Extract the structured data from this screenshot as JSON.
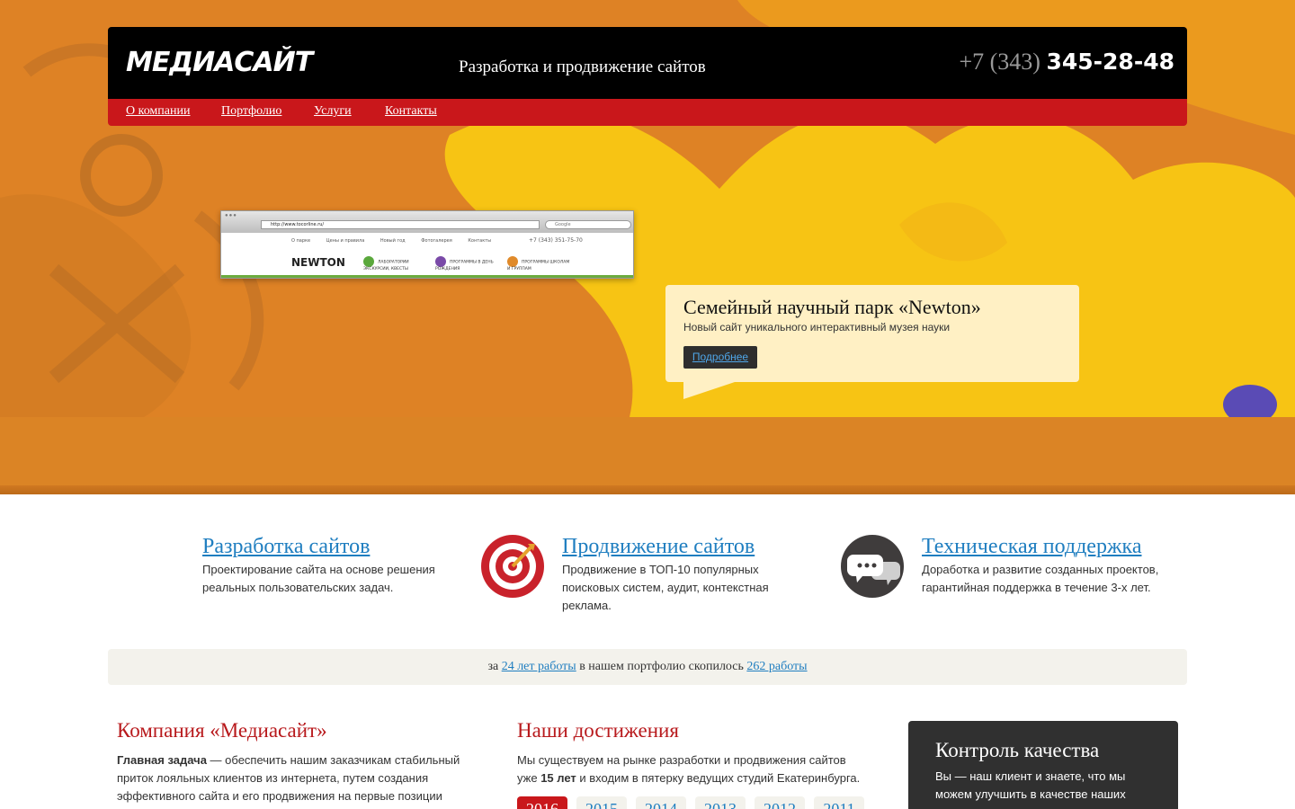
{
  "header": {
    "logo": "МЕДИАСАЙТ",
    "tagline": "Разработка и продвижение сайтов",
    "phone_code": "+7 (343)",
    "phone_number": "345-28-48"
  },
  "nav": {
    "items": [
      {
        "label": "О компании"
      },
      {
        "label": "Портфолио"
      },
      {
        "label": "Услуги"
      },
      {
        "label": "Контакты"
      }
    ]
  },
  "slide": {
    "browser": {
      "url": "http://www.tocorline.ru/",
      "search_placeholder": "Google",
      "menu": [
        "О парке",
        "Цены и правила",
        "Новый год",
        "Фотогалерея",
        "Контакты"
      ],
      "phone": "+7 (343) 351-75-70",
      "site_logo": "NEWTON",
      "services": [
        "ЛАБОРАТОРИИ ЭКСКУРСИИ, КВЕСТЫ",
        "ПРОГРАММЫ В ДЕНЬ РОЖДЕНИЯ",
        "ПРОГРАММЫ ШКОЛАМ И ГРУППАМ"
      ]
    },
    "title": "Семейный научный парк «Newton»",
    "subtitle": "Новый сайт уникального интерактивный музея науки",
    "button": "Подробнее"
  },
  "services": [
    {
      "title": "Разработка сайтов",
      "text": "Проектирование сайта на основе решения реальных пользовательских задач."
    },
    {
      "title": "Продвижение сайтов",
      "text": "Продвижение в ТОП-10 популярных поисковых систем, аудит, контекстная реклама."
    },
    {
      "title": "Техническая поддержка",
      "text": "Доработка и развитие созданных проектов, гарантийная поддержка в течение 3-х лет."
    }
  ],
  "stats": {
    "prefix": "за",
    "years_link": "24 лет работы",
    "middle": "в нашем портфолио скопилось",
    "works_link": "262 работы"
  },
  "company": {
    "title": "Компания «Медиасайт»",
    "lead_bold": "Главная задача",
    "text": " — обеспечить нашим заказчикам стабильный приток лояльных клиентов из интернета, путем создания эффективного сайта и его продвижения на первые позиции"
  },
  "achievements": {
    "title": "Наши достижения",
    "text_before": "Мы существуем на рынке разработки и продвижения сайтов уже ",
    "text_bold": "15 лет",
    "text_after": " и входим в пятерку ведущих студий Екатеринбурга.",
    "years": [
      "2016",
      "2015",
      "2014",
      "2013",
      "2012",
      "2011"
    ],
    "active_year": "2016"
  },
  "quality": {
    "title": "Контроль качества",
    "text": "Вы — наш клиент и знаете, что мы можем улучшить в качестве наших"
  },
  "colors": {
    "header_bg": "#000000",
    "nav_bg": "#c9171b",
    "hero_orange": "#de8225",
    "hero_yellow": "#f7c414",
    "link": "#1f7ec0",
    "heading_red": "#b8191c",
    "bubble_bg": "#fff0c4"
  }
}
